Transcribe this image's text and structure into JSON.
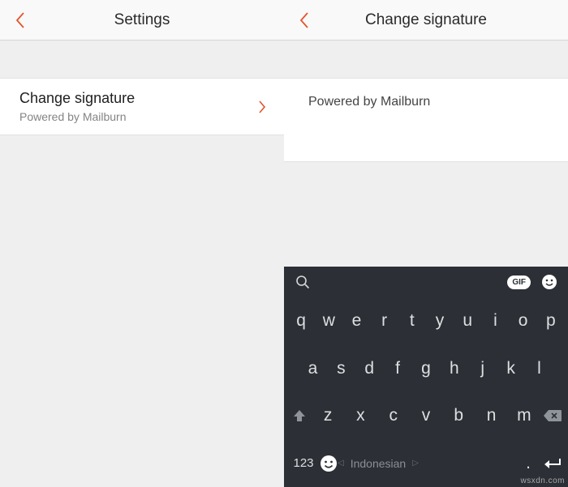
{
  "left": {
    "title": "Settings",
    "row": {
      "label": "Change signature",
      "sub": "Powered by Mailburn"
    }
  },
  "right": {
    "title": "Change signature",
    "signature_value": "Powered by Mailburn"
  },
  "keyboard": {
    "gif_label": "GIF",
    "row1": [
      "q",
      "w",
      "e",
      "r",
      "t",
      "y",
      "u",
      "i",
      "o",
      "p"
    ],
    "row2": [
      "a",
      "s",
      "d",
      "f",
      "g",
      "h",
      "j",
      "k",
      "l"
    ],
    "row3": [
      "z",
      "x",
      "c",
      "v",
      "b",
      "n",
      "m"
    ],
    "numbers_label": "123",
    "language": "Indonesian",
    "period": "."
  },
  "watermark": "wsxdn.com"
}
